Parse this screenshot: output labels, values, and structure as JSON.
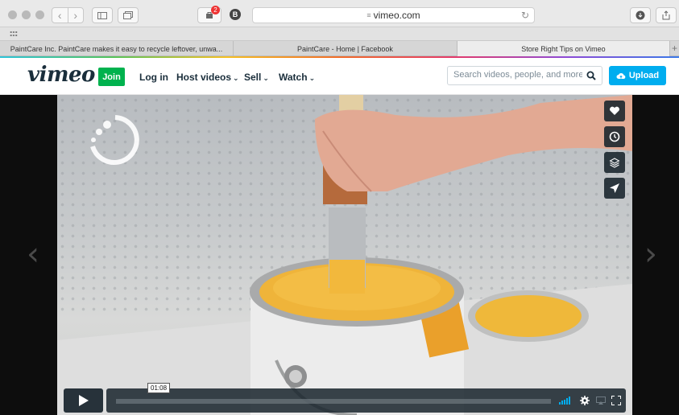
{
  "browser": {
    "address": "vimeo.com",
    "extension_badge": "2",
    "profile_letter": "B",
    "tabs": [
      {
        "label": "PaintCare Inc. PaintCare makes it easy to recycle leftover, unwa...",
        "active": false
      },
      {
        "label": "PaintCare - Home | Facebook",
        "active": false
      },
      {
        "label": "Store Right Tips on Vimeo",
        "active": true
      }
    ]
  },
  "header": {
    "logo": "vimeo",
    "join": "Join",
    "login": "Log in",
    "nav": [
      "Host videos",
      "Sell",
      "Watch"
    ],
    "search_placeholder": "Search videos, people, and more",
    "upload": "Upload"
  },
  "player": {
    "timecode": "01:08",
    "progress": 0.0,
    "side_buttons": [
      "heart-icon",
      "clock-icon",
      "layers-icon",
      "send-icon"
    ]
  },
  "colors": {
    "brand": "#00adef",
    "join_green": "#00b24e",
    "logo_dark": "#1a2e3b"
  }
}
